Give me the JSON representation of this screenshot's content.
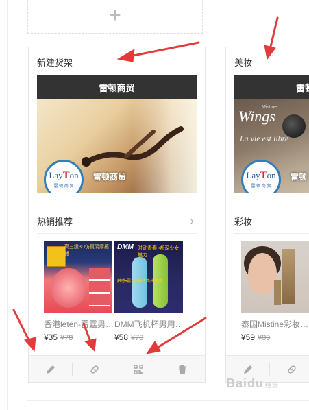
{
  "add_tile": {
    "plus": "+"
  },
  "card1": {
    "title": "新建货架",
    "store_name": "雷顿商贸",
    "banner_store_name": "雷顿商贸",
    "logo": {
      "text_a": "La",
      "text_b": "y",
      "text_c": "T",
      "text_d": "on",
      "sub": "雷 顿 商 贸"
    },
    "section_label": "热销推荐",
    "products": [
      {
        "name": "香港leten-雷霆男…",
        "price": "¥35",
        "old_price": "¥78",
        "img_header": "高三级3D仿真阴摩擦器"
      },
      {
        "name": "DMM飞机杯男用…",
        "price": "¥58",
        "old_price": "¥78",
        "img_brand": "DMM",
        "img_top": "时动青春 •都深少女魅力",
        "img_mid": "触感•震动&模式自由转换"
      }
    ],
    "toolbar": [
      "pencil-icon",
      "link-icon",
      "qrcode-icon",
      "trash-icon"
    ]
  },
  "card2": {
    "title": "美妆",
    "store_name": "雷顿",
    "banner_store_name": "雷顿",
    "banner_text_1": "Wings",
    "banner_text_2": "Mistine",
    "banner_text_3": "La vie est libre",
    "logo": {
      "text_a": "La",
      "text_b": "y",
      "text_c": "T",
      "text_d": "on",
      "sub": "雷 顿 商 贸"
    },
    "section_label": "彩妆",
    "products": [
      {
        "name": "泰国Mistine彩妆…",
        "price": "¥59",
        "old_price": "¥89"
      }
    ],
    "toolbar": [
      "pencil-icon",
      "link-icon"
    ]
  },
  "watermark": {
    "main": "Baidu",
    "suffix": "经验"
  },
  "colors": {
    "store_bar": "#333333",
    "logo_ring": "#2f7ec0",
    "annotation_arrow": "#e23b3b"
  }
}
